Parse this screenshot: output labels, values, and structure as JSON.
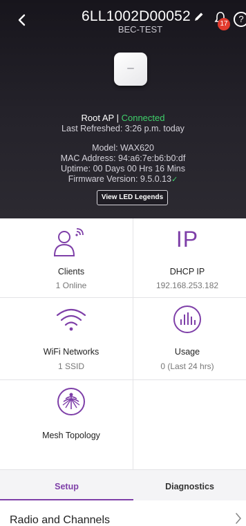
{
  "header": {
    "title": "6LL1002D00052",
    "subtitle": "BEC-TEST",
    "notification_count": "17",
    "help_label": "?"
  },
  "status": {
    "role": "Root AP |",
    "state": "Connected",
    "last_refreshed": "Last Refreshed: 3:26 p.m. today",
    "model": "Model: WAX620",
    "mac": "MAC Address: 94:a6:7e:b6:b0:df",
    "uptime": "Uptime: 00 Days 00 Hrs 16 Mins",
    "firmware": "Firmware Version: 9.5.0.13",
    "led_button": "View LED Legends"
  },
  "tiles": {
    "clients": {
      "label": "Clients",
      "value": "1 Online"
    },
    "dhcp": {
      "icon_text": "IP",
      "label": "DHCP IP",
      "value": "192.168.253.182"
    },
    "wifi": {
      "label": "WiFi Networks",
      "value": "1 SSID"
    },
    "usage": {
      "label": "Usage",
      "value": "0 (Last 24 hrs)"
    },
    "mesh": {
      "label": "Mesh Topology"
    }
  },
  "tabs": {
    "setup": "Setup",
    "diagnostics": "Diagnostics"
  },
  "rows": {
    "radio": "Radio and Channels"
  },
  "colors": {
    "accent": "#7e3fa8",
    "connected": "#3fd06a",
    "badge": "#e23b2e"
  }
}
